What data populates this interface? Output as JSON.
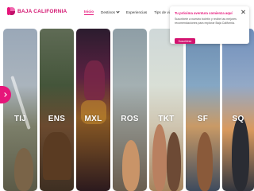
{
  "brand": {
    "name": "BAJA CALIFORNIA",
    "color": "#e6157a"
  },
  "nav": {
    "items": [
      {
        "label": "Inicio",
        "active": true
      },
      {
        "label": "Destinos",
        "has_dropdown": true
      },
      {
        "label": "Experiencias"
      },
      {
        "label": "Tips de viaje"
      }
    ]
  },
  "destinations": [
    {
      "code": "TIJ"
    },
    {
      "code": "ENS"
    },
    {
      "code": "MXL"
    },
    {
      "code": "ROS"
    },
    {
      "code": "TKT"
    },
    {
      "code": "SF"
    },
    {
      "code": "SQ"
    }
  ],
  "popup": {
    "title": "Tu próxima aventura comienza aquí",
    "body": "Suscríbete a nuestro boletín y recibe las mejores recomendaciones para explorar Baja California.",
    "button_label": "Suscribirse"
  },
  "icons": {
    "prev_arrow": "chevron-right-icon",
    "close": "close-icon",
    "dropdown": "chevron-down-icon"
  }
}
